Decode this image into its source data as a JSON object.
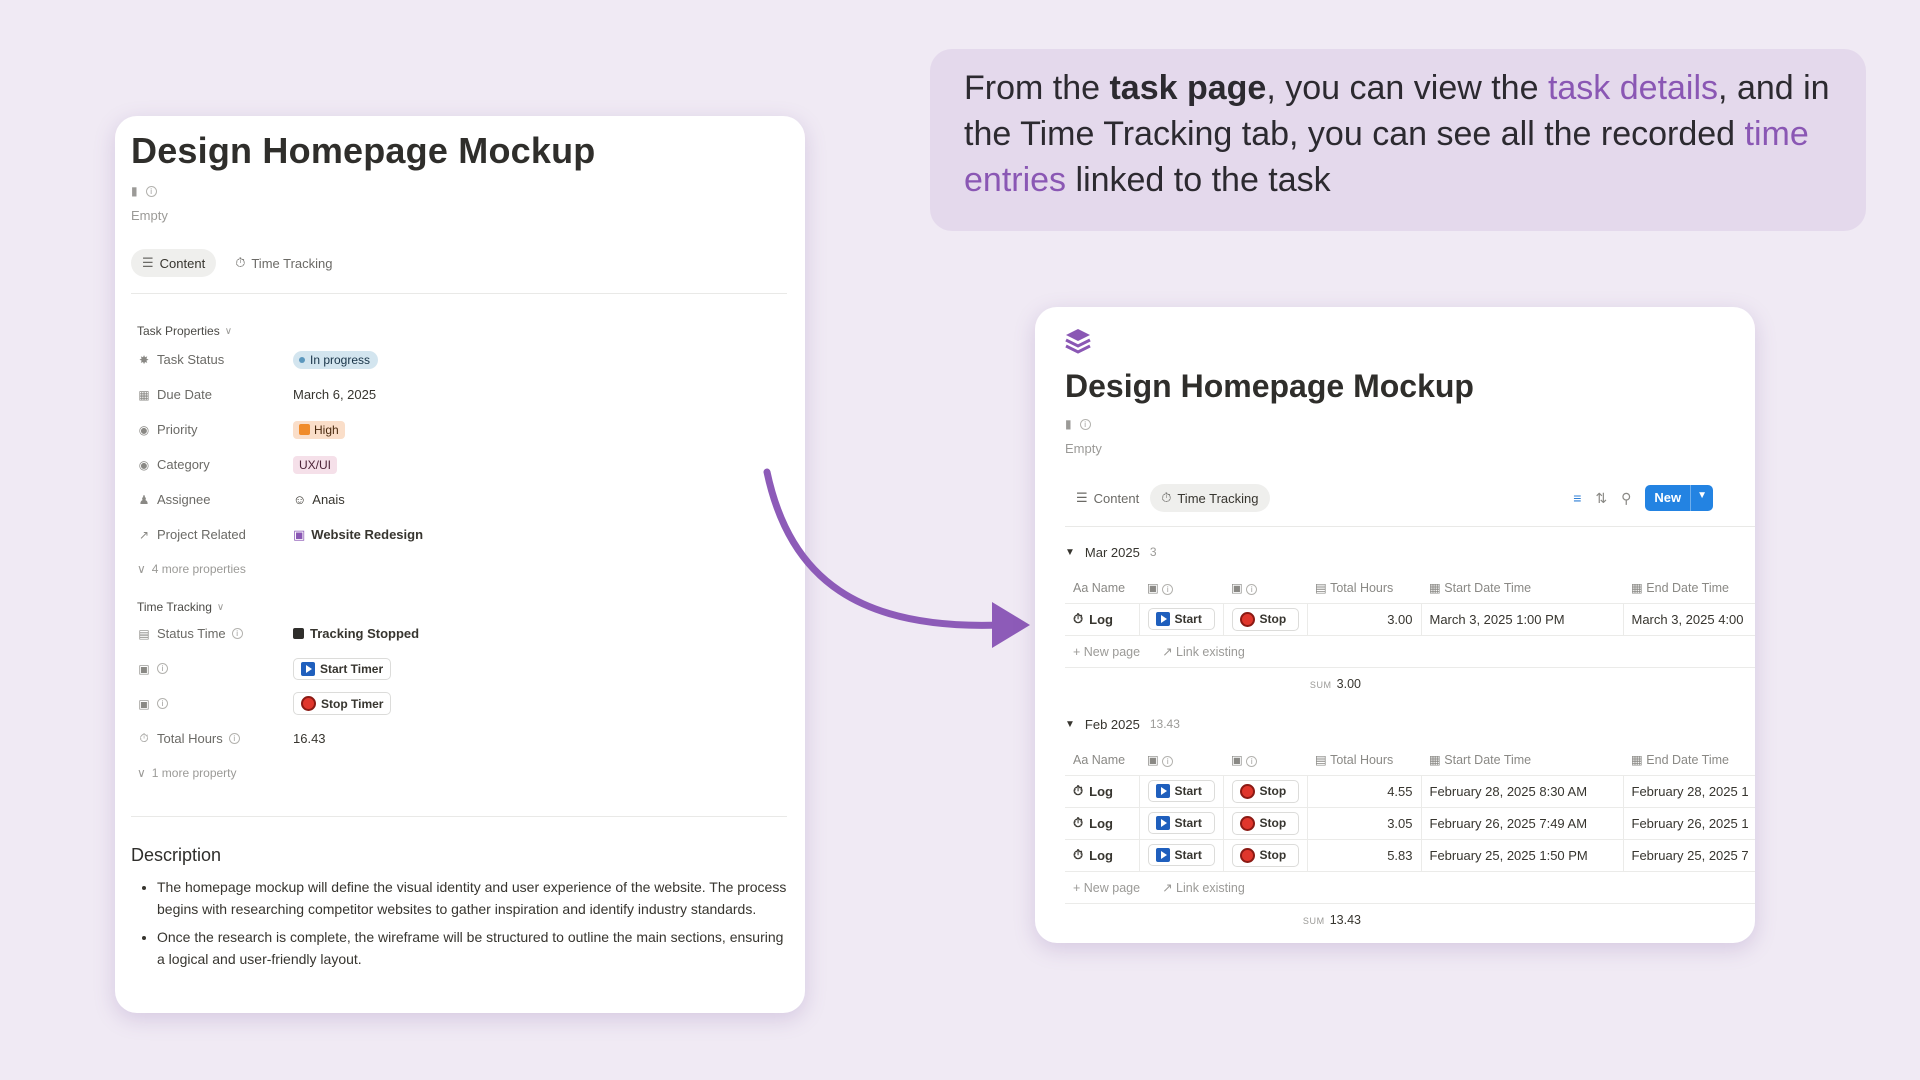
{
  "callout": {
    "p1": "From the ",
    "b1": "task page",
    "p2": ", you can view the ",
    "h1": "task details",
    "p3": ", and in the Time Tracking tab, you can see all the recorded ",
    "h2": "time entries",
    "p4": " linked to the task"
  },
  "left": {
    "title": "Design Homepage Mockup",
    "empty": "Empty",
    "tabs": [
      {
        "label": "Content"
      },
      {
        "label": "Time Tracking"
      }
    ],
    "task_properties": "Task Properties",
    "props": [
      {
        "name": "Task Status",
        "value": "In progress"
      },
      {
        "name": "Due Date",
        "value": "March 6, 2025"
      },
      {
        "name": "Priority",
        "value": "High"
      },
      {
        "name": "Category",
        "value": "UX/UI"
      },
      {
        "name": "Assignee",
        "value": "Anais"
      },
      {
        "name": "Project Related",
        "value": "Website Redesign"
      }
    ],
    "more_props": "4 more properties",
    "time_tracking": "Time Tracking",
    "tt_props": [
      {
        "name": "Status Time",
        "value": "Tracking Stopped"
      },
      {
        "name": "",
        "value": "Start Timer"
      },
      {
        "name": "",
        "value": "Stop Timer"
      },
      {
        "name": "Total Hours",
        "value": "16.43"
      }
    ],
    "more_prop": "1 more property",
    "description_title": "Description",
    "description": [
      "The homepage mockup will define the visual identity and user experience of the website. The process begins with researching competitor websites to gather inspiration and identify industry standards.",
      "Once the research is complete, the wireframe will be structured to outline the main sections, ensuring a logical and user-friendly layout."
    ]
  },
  "right": {
    "title": "Design Homepage Mockup",
    "empty": "Empty",
    "tabs": [
      {
        "label": "Content"
      },
      {
        "label": "Time Tracking"
      }
    ],
    "new_label": "New",
    "columns": {
      "name": "Name",
      "total": "Total Hours",
      "start": "Start Date Time",
      "end": "End Date Time"
    },
    "aa": "Aa",
    "start_label": "Start",
    "stop_label": "Stop",
    "log_label": "Log",
    "new_page": "New page",
    "link_existing": "Link existing",
    "sum_label": "SUM",
    "groups": [
      {
        "name": "Mar 2025",
        "count": "3",
        "sum": "3.00",
        "rows": [
          {
            "total": "3.00",
            "start": "March 3, 2025 1:00 PM",
            "end": "March 3, 2025 4:00"
          }
        ]
      },
      {
        "name": "Feb 2025",
        "count": "13.43",
        "sum": "13.43",
        "rows": [
          {
            "total": "4.55",
            "start": "February 28, 2025 8:30 AM",
            "end": "February 28, 2025 1"
          },
          {
            "total": "3.05",
            "start": "February 26, 2025 7:49 AM",
            "end": "February 26, 2025 1"
          },
          {
            "total": "5.83",
            "start": "February 25, 2025 1:50 PM",
            "end": "February 25, 2025 7"
          }
        ]
      }
    ]
  },
  "colors": {
    "background": "#f0eaf4",
    "accent_purple": "#8a57b4",
    "callout_bg": "#e4d9ec",
    "new_button": "#2383e2"
  }
}
